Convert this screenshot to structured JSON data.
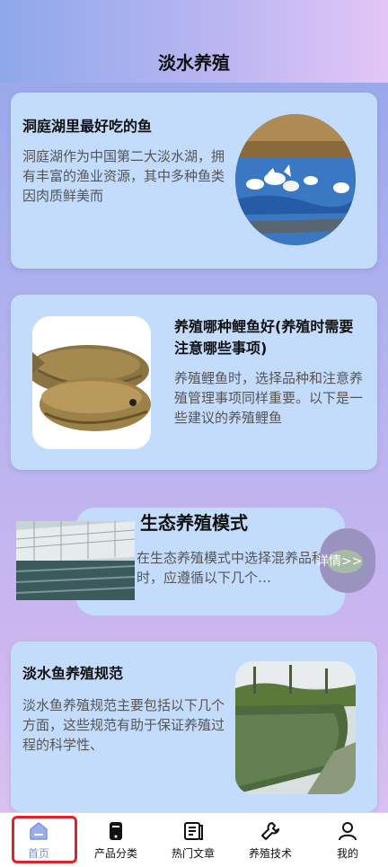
{
  "header": {
    "title": "淡水养殖"
  },
  "cards": [
    {
      "title": "洞庭湖里最好吃的鱼",
      "desc": "洞庭湖作为中国第二大淡水湖，拥有丰富的渔业资源，其中多种鱼类因肉质鲜美而"
    },
    {
      "title": "养殖哪种鲤鱼好(养殖时需要注意哪些事项)",
      "desc": "养殖鲤鱼时，选择品种和注意养殖管理事项同样重要。以下是一些建议的养殖鲤鱼"
    },
    {
      "title": "生态养殖模式",
      "desc": "在生态养殖模式中选择混养品种时，应遵循以下几个…",
      "details_label": "详情>>"
    },
    {
      "title": "淡水鱼养殖规范",
      "desc": "淡水鱼养殖规范主要包括以下几个方面，这些规范有助于保证养殖过程的科学性、"
    }
  ],
  "tabbar": {
    "items": [
      {
        "label": "首页",
        "icon": "home-icon",
        "active": true
      },
      {
        "label": "产品分类",
        "icon": "phone-icon"
      },
      {
        "label": "热门文章",
        "icon": "article-icon"
      },
      {
        "label": "养殖技术",
        "icon": "wrench-icon"
      },
      {
        "label": "我的",
        "icon": "user-icon"
      }
    ]
  },
  "colors": {
    "card": "#c3dcfb",
    "highlight": "#e0222a",
    "active_tab": "#9aaee8"
  }
}
